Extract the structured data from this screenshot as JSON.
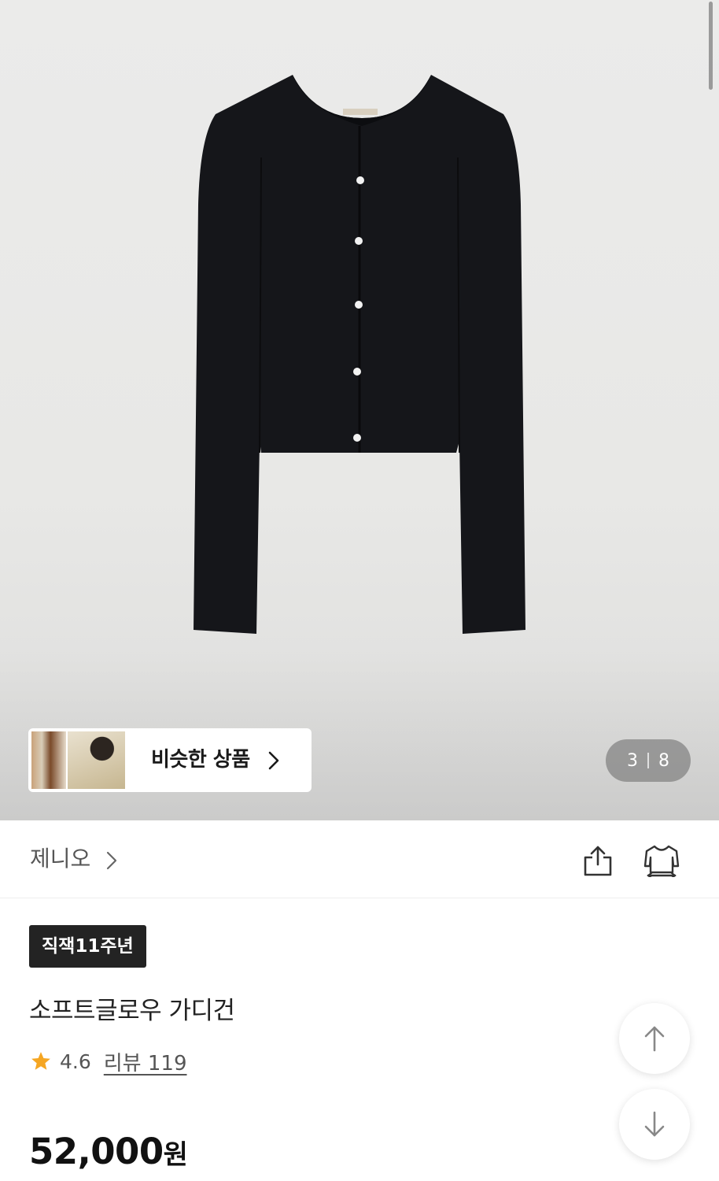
{
  "gallery": {
    "image_alt": "black knit cardigan",
    "counter_current": "3",
    "counter_total": "8",
    "similar_label": "비슷한 상품"
  },
  "brand": {
    "name": "제니오"
  },
  "product": {
    "badge": "직잭11주년",
    "title": "소프트글로우 가디건",
    "rating": "4.6",
    "review_label": "리뷰 119",
    "price": "52,000",
    "price_unit": "원"
  },
  "icons": {
    "share": "share-icon",
    "fit": "size-fit-icon",
    "star": "star-icon",
    "scroll_up": "arrow-up-icon",
    "scroll_down": "arrow-down-icon"
  },
  "colors": {
    "star": "#F5A623",
    "badge_bg": "#232323",
    "counter_bg": "#8a8a8a"
  }
}
